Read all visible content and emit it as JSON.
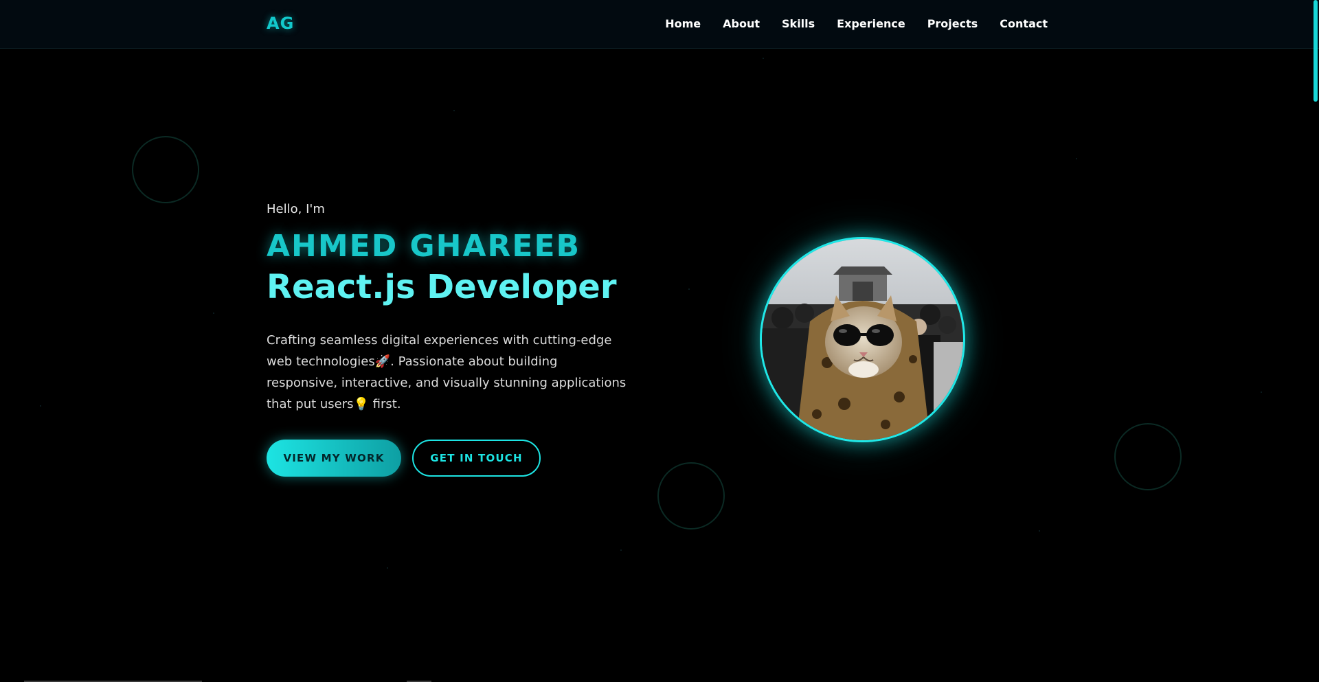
{
  "nav": {
    "logo": "AG",
    "links": [
      "Home",
      "About",
      "Skills",
      "Experience",
      "Projects",
      "Contact"
    ]
  },
  "hero": {
    "greeting": "Hello, I'm",
    "name": "AHMED GHAREEB",
    "role": "React.js Developer",
    "intro_1": "Crafting seamless digital experiences with cutting-edge web technologies",
    "emoji_rocket": "🚀",
    "intro_2": ". Passionate about building responsive, interactive, and visually stunning applications that put users",
    "emoji_bulb": "💡",
    "intro_3": " first.",
    "primary_button": "VIEW MY WORK",
    "secondary_button": "GET IN TOUCH"
  },
  "colors": {
    "accent": "#18c7c9",
    "accent_light": "#5ff2f2",
    "background": "#000000",
    "navbar": "#020a10"
  }
}
